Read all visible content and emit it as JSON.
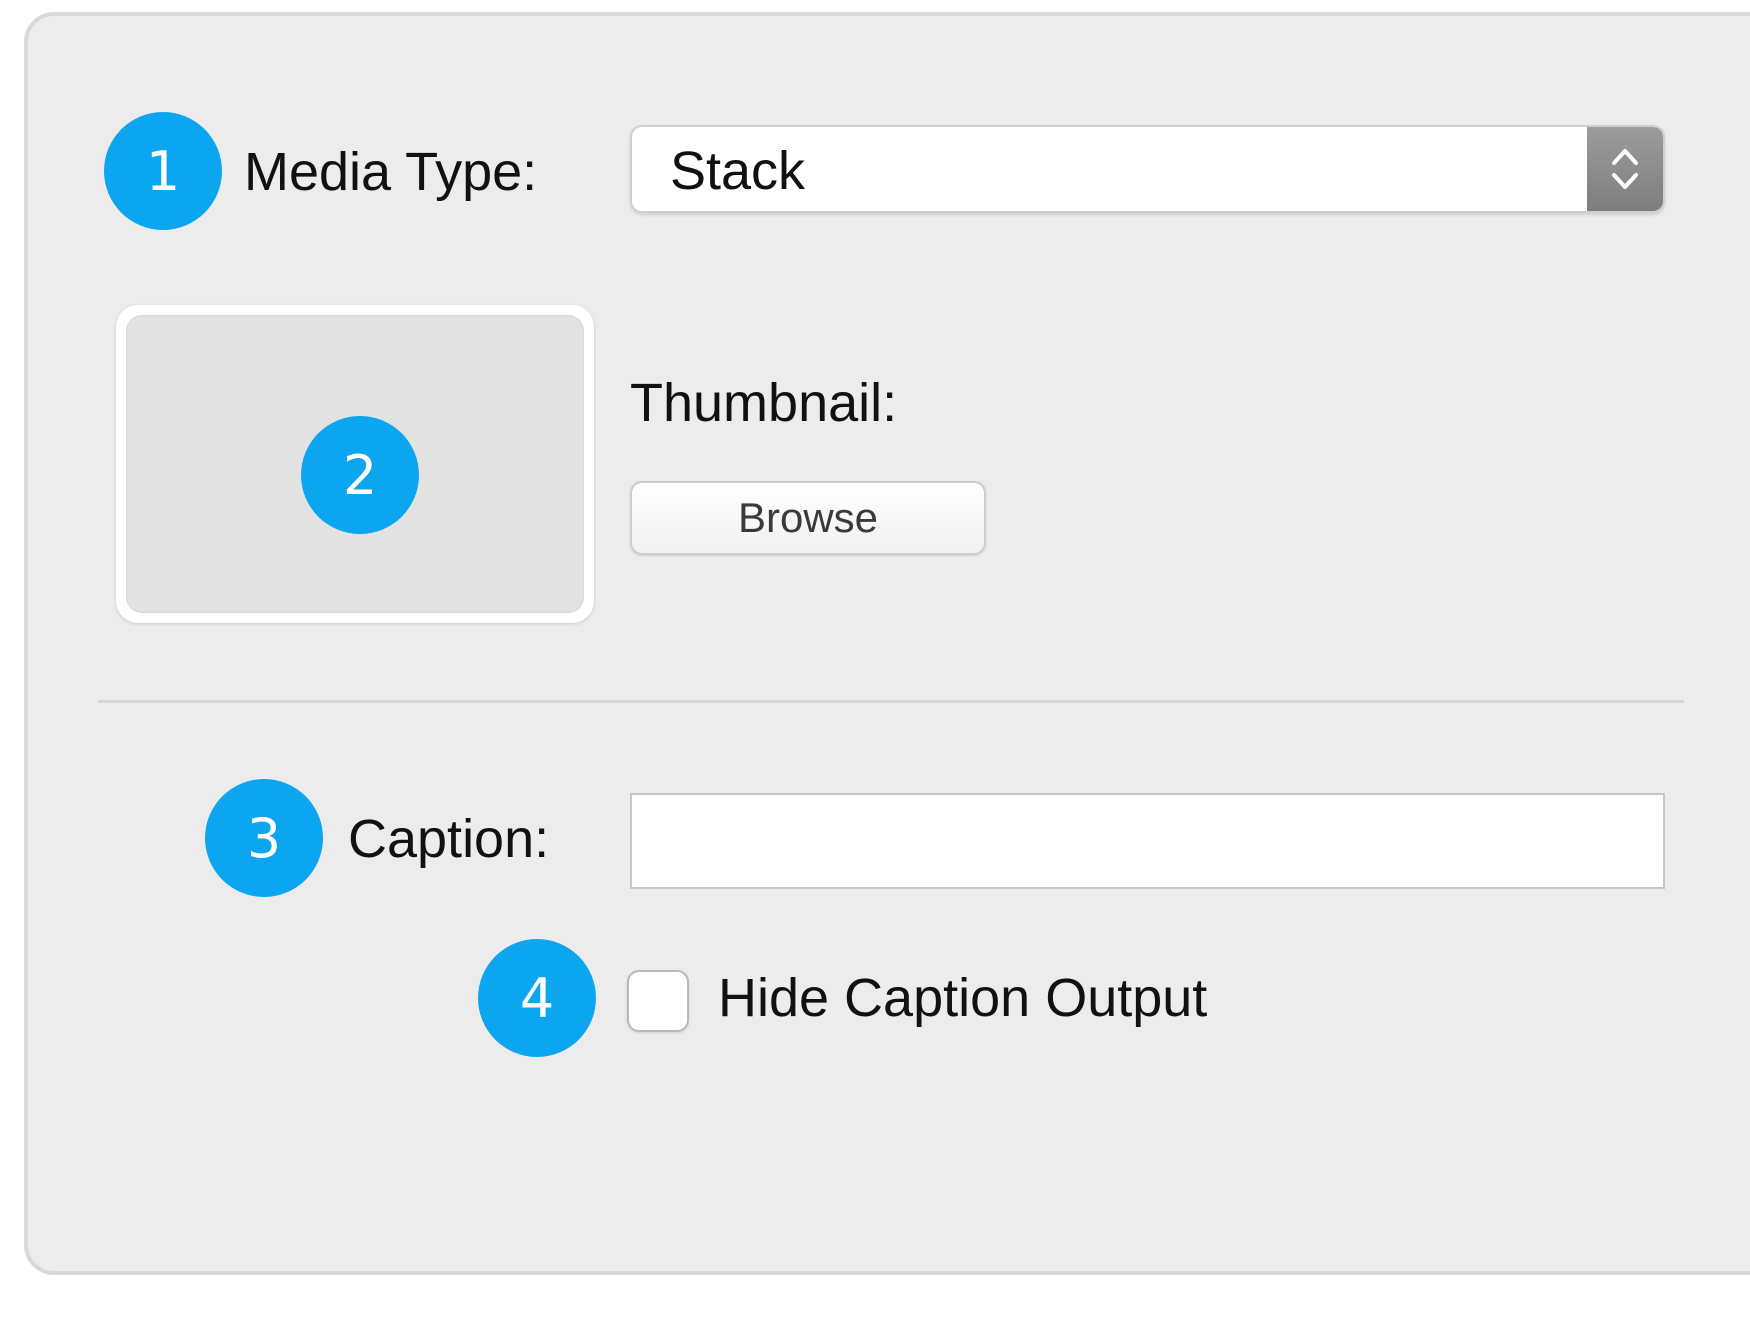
{
  "media_type": {
    "label": "Media Type:",
    "selected_value": "Stack",
    "arrows_icon": "up-down-chevron-icon"
  },
  "thumbnail": {
    "label": "Thumbnail:",
    "browse_label": "Browse"
  },
  "caption": {
    "label": "Caption:",
    "value": "",
    "placeholder": ""
  },
  "hide_caption": {
    "label": "Hide Caption Output",
    "checked": false
  },
  "callouts": [
    "1",
    "2",
    "3",
    "4"
  ],
  "colors": {
    "callout": "#0ba5f0",
    "panel_background": "#ececec"
  }
}
